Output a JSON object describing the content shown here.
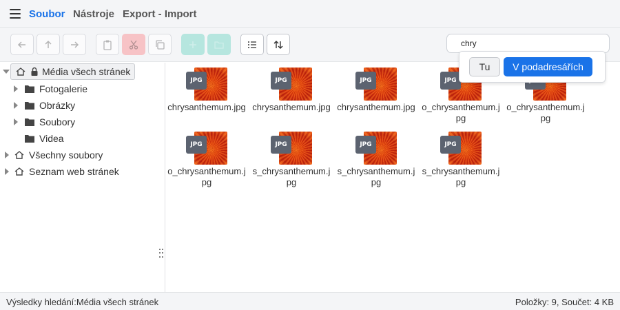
{
  "menu": {
    "items": [
      {
        "label": "Soubor",
        "active": true
      },
      {
        "label": "Nástroje",
        "active": false
      },
      {
        "label": "Export - Import",
        "active": false
      }
    ]
  },
  "toolbar": {
    "buttons": [
      {
        "icon": "arrow-left-icon",
        "state": "disabled"
      },
      {
        "icon": "arrow-up-icon",
        "state": "disabled"
      },
      {
        "icon": "arrow-right-icon",
        "state": "disabled"
      },
      {
        "icon": "paste-icon",
        "state": "disabled"
      },
      {
        "icon": "cut-icon",
        "state": "disabled"
      },
      {
        "icon": "copy-icon",
        "state": "disabled"
      },
      {
        "icon": "add-file-icon",
        "state": "disabled"
      },
      {
        "icon": "add-folder-icon",
        "state": "disabled"
      },
      {
        "icon": "list-view-icon",
        "state": "enabled"
      },
      {
        "icon": "sort-icon",
        "state": "enabled"
      }
    ],
    "search_value": "chry"
  },
  "search_popup": {
    "here_label": "Tu",
    "subfolders_label": "V podadresářích"
  },
  "tree": {
    "root": "Média všech stránek",
    "children": [
      "Fotogalerie",
      "Obrázky",
      "Soubory",
      "Videa"
    ],
    "other_roots": [
      "Všechny soubory",
      "Seznam web stránek"
    ]
  },
  "files": [
    {
      "name": "chrysanthemum.jpg",
      "type": "JPG"
    },
    {
      "name": "chrysanthemum.jpg",
      "type": "JPG"
    },
    {
      "name": "chrysanthemum.jpg",
      "type": "JPG"
    },
    {
      "name": "o_chrysanthemum.jpg",
      "type": "JPG"
    },
    {
      "name": "o_chrysanthemum.jpg",
      "type": "JPG"
    },
    {
      "name": "o_chrysanthemum.jpg",
      "type": "JPG"
    },
    {
      "name": "s_chrysanthemum.jpg",
      "type": "JPG"
    },
    {
      "name": "s_chrysanthemum.jpg",
      "type": "JPG"
    },
    {
      "name": "s_chrysanthemum.jpg",
      "type": "JPG"
    }
  ],
  "status": {
    "left": "Výsledky hledání:Média všech stránek",
    "right": "Položky: 9, Součet: 4 KB"
  },
  "colors": {
    "accent": "#1a73e8",
    "danger_button": "#f7c3c6",
    "success_button": "#b6e6df",
    "file_badge": "#5c6370"
  }
}
